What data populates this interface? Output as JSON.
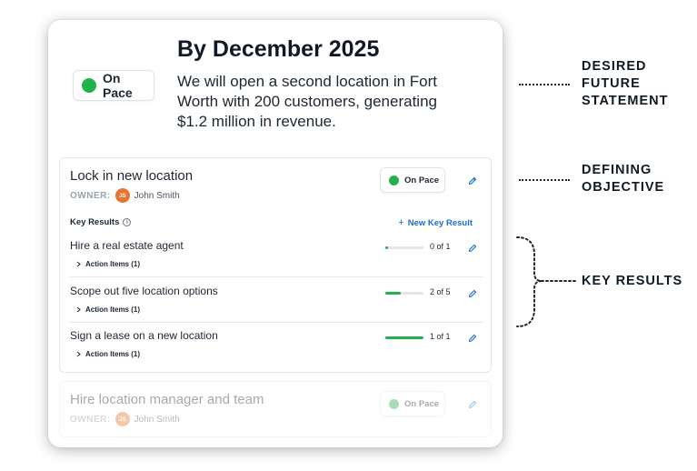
{
  "colors": {
    "on_pace": "#22b14c",
    "accent": "#1c6fd1",
    "avatar": "#e8742f"
  },
  "header": {
    "status": "On Pace",
    "title": "By December 2025",
    "statement": "We will open a second location in Fort Worth with 200 customers, generating $1.2 million in revenue."
  },
  "objectives": [
    {
      "name": "Lock in new location",
      "owner_label": "OWNER:",
      "owner_initials": "JS",
      "owner_name": "John Smith",
      "status": "On Pace",
      "key_results_label": "Key Results",
      "new_key_result_label": "New Key Result",
      "key_results": [
        {
          "name": "Hire a real estate agent",
          "action_items": "Action Items (1)",
          "progress": "0 of 1",
          "done": 0,
          "total": 1
        },
        {
          "name": "Scope out five location options",
          "action_items": "Action Items (1)",
          "progress": "2 of 5",
          "done": 2,
          "total": 5
        },
        {
          "name": "Sign a lease on a new location",
          "action_items": "Action Items (1)",
          "progress": "1 of 1",
          "done": 1,
          "total": 1
        }
      ]
    },
    {
      "name": "Hire location manager and team",
      "owner_label": "OWNER:",
      "owner_initials": "JS",
      "owner_name": "John Smith",
      "status": "On Pace"
    }
  ],
  "annotations": {
    "desired_future_statement": [
      "DESIRED",
      "FUTURE",
      "STATEMENT"
    ],
    "defining_objective": [
      "DEFINING",
      "OBJECTIVE"
    ],
    "key_results": [
      "KEY RESULTS"
    ]
  }
}
